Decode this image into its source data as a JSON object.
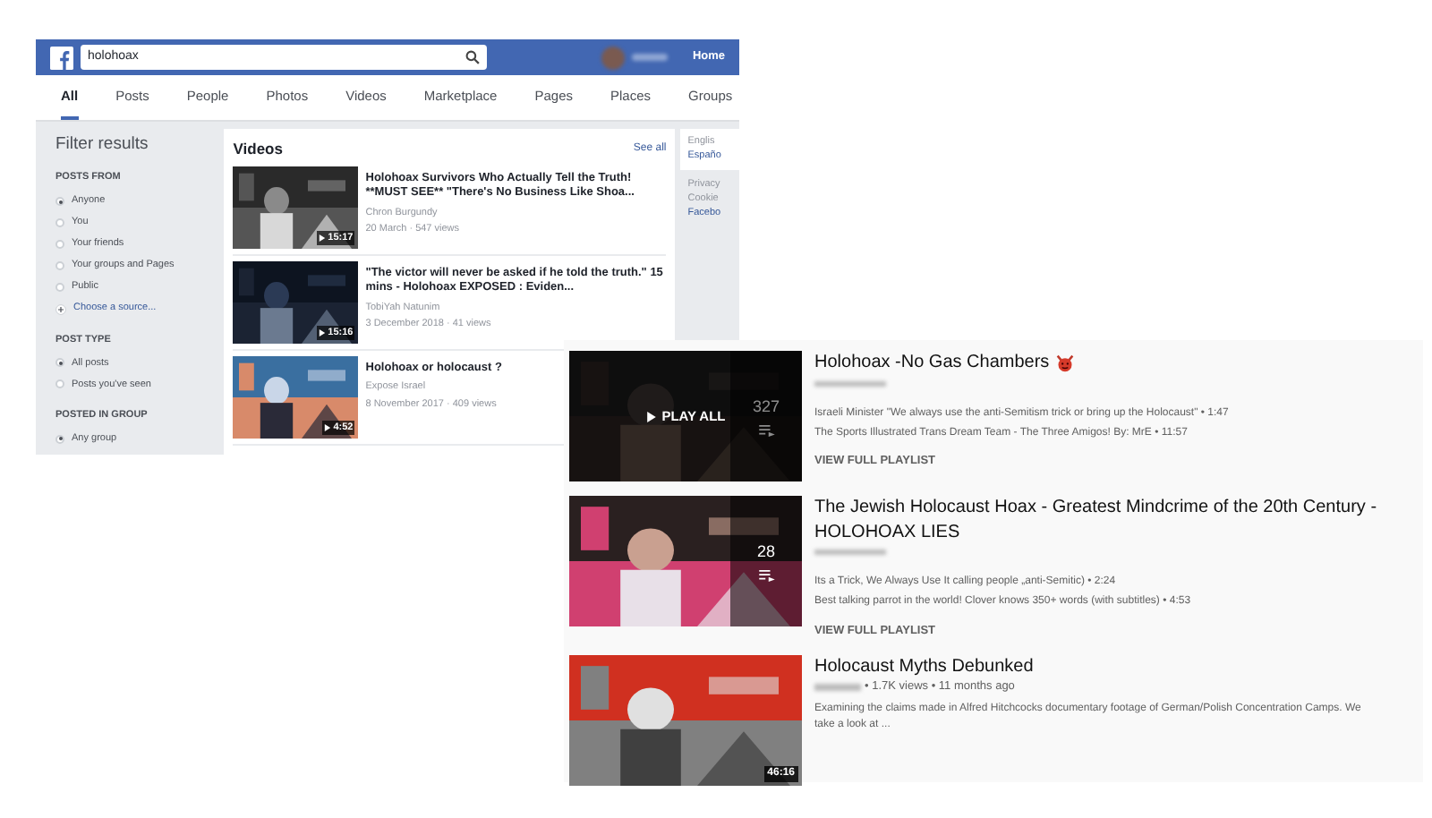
{
  "facebook": {
    "search": {
      "value": "holohoax"
    },
    "account": {
      "label": "Home"
    },
    "tabs": [
      {
        "label": "All",
        "selected": true
      },
      {
        "label": "Posts",
        "selected": false
      },
      {
        "label": "People",
        "selected": false
      },
      {
        "label": "Photos",
        "selected": false
      },
      {
        "label": "Videos",
        "selected": false
      },
      {
        "label": "Marketplace",
        "selected": false
      },
      {
        "label": "Pages",
        "selected": false
      },
      {
        "label": "Places",
        "selected": false
      },
      {
        "label": "Groups",
        "selected": false
      }
    ],
    "filters": {
      "title": "Filter results",
      "sections": [
        {
          "heading": "POSTS FROM",
          "options": [
            {
              "label": "Anyone",
              "selected": true,
              "kind": "radio"
            },
            {
              "label": "You",
              "selected": false,
              "kind": "radio"
            },
            {
              "label": "Your friends",
              "selected": false,
              "kind": "radio"
            },
            {
              "label": "Your groups and Pages",
              "selected": false,
              "kind": "radio"
            },
            {
              "label": "Public",
              "selected": false,
              "kind": "radio"
            },
            {
              "label": "Choose a source...",
              "selected": false,
              "kind": "link"
            }
          ]
        },
        {
          "heading": "POST TYPE",
          "options": [
            {
              "label": "All posts",
              "selected": true,
              "kind": "radio"
            },
            {
              "label": "Posts you've seen",
              "selected": false,
              "kind": "radio"
            }
          ]
        },
        {
          "heading": "POSTED IN GROUP",
          "options": [
            {
              "label": "Any group",
              "selected": true,
              "kind": "radio"
            }
          ]
        }
      ]
    },
    "videos": {
      "title": "Videos",
      "see_all": "See all",
      "items": [
        {
          "title": "Holohoax Survivors Who Actually Tell the Truth! **MUST SEE** \"There's No Business Like Shoa...",
          "channel": "Chron Burgundy",
          "meta": "20 March · 547 views",
          "duration": "15:17"
        },
        {
          "title": "\"The victor will never be asked if he told the truth.\" 15 mins - Holohoax EXPOSED : Eviden...",
          "channel": "TobiYah Natunim",
          "meta": "3 December 2018 · 41 views",
          "duration": "15:16"
        },
        {
          "title": "Holohoax or holocaust ?",
          "channel": "Expose Israel",
          "meta": "8 November 2017 · 409 views",
          "duration": "4:52"
        }
      ]
    },
    "right_column": {
      "languages": [
        "Englis",
        "Españo"
      ],
      "links": [
        "Privacy",
        "Cookie",
        "Facebo"
      ]
    }
  },
  "youtube": {
    "items": [
      {
        "kind": "playlist",
        "title": "Holohoax -No Gas Chambers",
        "has_emoji": true,
        "overlay": "PLAY ALL",
        "count": "327",
        "entries": [
          "Israeli Minister \"We always use the anti-Semitism trick or bring up the Holocaust\" • 1:47",
          "The Sports Illustrated Trans Dream Team - The Three Amigos! By: MrE • 11:57"
        ],
        "link": "VIEW FULL PLAYLIST"
      },
      {
        "kind": "playlist",
        "title": "The Jewish Holocaust Hoax - Greatest Mindcrime of the 20th Century - HOLOHOAX LIES",
        "has_emoji": false,
        "count": "28",
        "entries": [
          "Its a Trick, We Always Use It calling people „anti-Semitic) • 2:24",
          "Best talking parrot in the world! Clover knows 350+ words (with subtitles) • 4:53"
        ],
        "link": "VIEW FULL PLAYLIST"
      },
      {
        "kind": "video",
        "title": "Holocaust Myths Debunked",
        "meta": "• 1.7K views • 11 months ago",
        "description": "Examining the claims made in Alfred Hitchcocks documentary footage of German/Polish Concentration Camps. We take a look at ...",
        "duration": "46:16"
      }
    ]
  }
}
